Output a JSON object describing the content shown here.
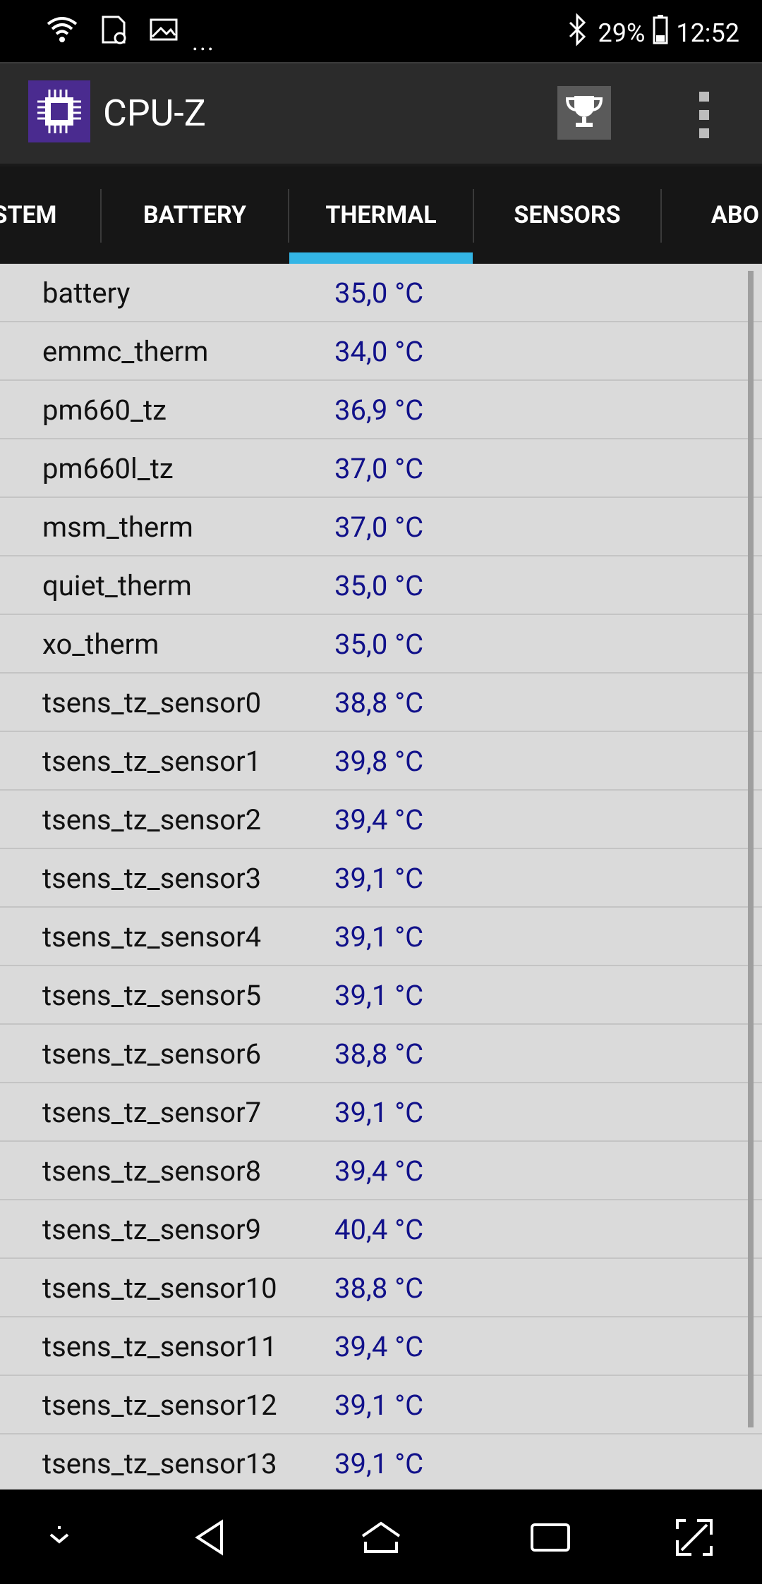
{
  "status_bar": {
    "battery": "29%",
    "time": "12:52",
    "ellipsis": "..."
  },
  "app": {
    "title": "CPU-Z"
  },
  "tabs": [
    {
      "label": "STEM"
    },
    {
      "label": "BATTERY"
    },
    {
      "label": "THERMAL",
      "selected": true
    },
    {
      "label": "SENSORS"
    },
    {
      "label": "ABO"
    }
  ],
  "sensors": [
    {
      "name": "battery",
      "value": "35,0 °C"
    },
    {
      "name": "emmc_therm",
      "value": "34,0 °C"
    },
    {
      "name": "pm660_tz",
      "value": "36,9 °C"
    },
    {
      "name": "pm660l_tz",
      "value": "37,0 °C"
    },
    {
      "name": "msm_therm",
      "value": "37,0 °C"
    },
    {
      "name": "quiet_therm",
      "value": "35,0 °C"
    },
    {
      "name": "xo_therm",
      "value": "35,0 °C"
    },
    {
      "name": "tsens_tz_sensor0",
      "value": "38,8 °C"
    },
    {
      "name": "tsens_tz_sensor1",
      "value": "39,8 °C"
    },
    {
      "name": "tsens_tz_sensor2",
      "value": "39,4 °C"
    },
    {
      "name": "tsens_tz_sensor3",
      "value": "39,1 °C"
    },
    {
      "name": "tsens_tz_sensor4",
      "value": "39,1 °C"
    },
    {
      "name": "tsens_tz_sensor5",
      "value": "39,1 °C"
    },
    {
      "name": "tsens_tz_sensor6",
      "value": "38,8 °C"
    },
    {
      "name": "tsens_tz_sensor7",
      "value": "39,1 °C"
    },
    {
      "name": "tsens_tz_sensor8",
      "value": "39,4 °C"
    },
    {
      "name": "tsens_tz_sensor9",
      "value": "40,4 °C"
    },
    {
      "name": "tsens_tz_sensor10",
      "value": "38,8 °C"
    },
    {
      "name": "tsens_tz_sensor11",
      "value": "39,4 °C"
    },
    {
      "name": "tsens_tz_sensor12",
      "value": "39,1 °C"
    },
    {
      "name": "tsens_tz_sensor13",
      "value": "39,1 °C"
    }
  ],
  "colors": {
    "tab_indicator": "#33b5e5",
    "value_text": "#11118a",
    "list_bg": "#dadada",
    "logo_bg": "#4a2b8f"
  },
  "icons": [
    "wifi-icon",
    "sd-card-icon",
    "image-icon",
    "bluetooth-icon",
    "battery-icon",
    "trophy-icon",
    "overflow-menu-icon",
    "nav-down-icon",
    "nav-back-icon",
    "nav-home-icon",
    "nav-recents-icon",
    "nav-expand-icon"
  ]
}
